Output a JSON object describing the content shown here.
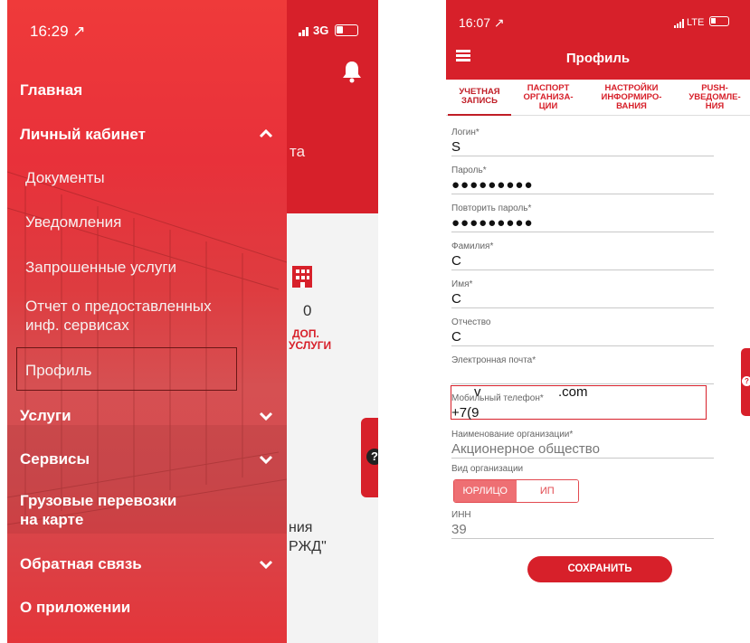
{
  "left": {
    "status": {
      "time": "16:29 ↗",
      "network": "3G"
    },
    "background_fragments": {
      "ta": "та",
      "count": "0",
      "dop": "ДОП.",
      "uslugi": "УСЛУГИ",
      "niya": "ния",
      "rzhd": "РЖД\"",
      "help_icon": "question-icon"
    },
    "menu": {
      "glavnaya": "Главная",
      "lichny": "Личный кабинет",
      "documents": "Документы",
      "notifications": "Уведомления",
      "requested": "Запрошенные услуги",
      "report_1": "Отчет о предоставленных",
      "report_2": "инф. сервисах",
      "profile": "Профиль",
      "services": "Услуги",
      "servisy": "Сервисы",
      "cargo_1": "Грузовые перевозки",
      "cargo_2": "на карте",
      "feedback": "Обратная связь",
      "about": "О приложении"
    },
    "colors": {
      "brand_red": "#d7202a"
    }
  },
  "right": {
    "status": {
      "time": "16:07 ↗",
      "network": "LTE"
    },
    "title": "Профиль",
    "tabs": {
      "account_1": "УЧЕТНАЯ",
      "account_2": "ЗАПИСЬ",
      "passport_1": "ПАСПОРТ",
      "passport_2": "ОРГАНИЗА-",
      "passport_3": "ЦИИ",
      "settings_1": "НАСТРОЙКИ",
      "settings_2": "ИНФОРМИРО-",
      "settings_3": "ВАНИЯ",
      "push_1": "PUSH-",
      "push_2": "УВЕДОМЛЕ-",
      "push_3": "НИЯ"
    },
    "fields": {
      "login": {
        "label": "Логин*",
        "value": "S"
      },
      "password": {
        "label": "Пароль*",
        "value": "●●●●●●●●●"
      },
      "password_repeat": {
        "label": "Повторить пароль*",
        "value": "●●●●●●●●●"
      },
      "surname": {
        "label": "Фамилия*",
        "value": "C"
      },
      "name": {
        "label": "Имя*",
        "value": "C"
      },
      "patronymic": {
        "label": "Отчество",
        "value": "C"
      },
      "email": {
        "label": "Электронная почта*",
        "value": "v",
        "value_suffix": ".com"
      },
      "phone": {
        "label": "Мобильный телефон*",
        "value": "+7(9"
      },
      "org_name": {
        "label": "Наименование организации*",
        "value": "Акционерное общество"
      },
      "org_type": {
        "label": "Вид организации",
        "opt_legal": "ЮРЛИЦО",
        "opt_ip": "ИП",
        "selected": "ЮРЛИЦО"
      },
      "inn": {
        "label": "ИНН",
        "value": "39"
      }
    },
    "save_label": "СОХРАНИТЬ"
  }
}
